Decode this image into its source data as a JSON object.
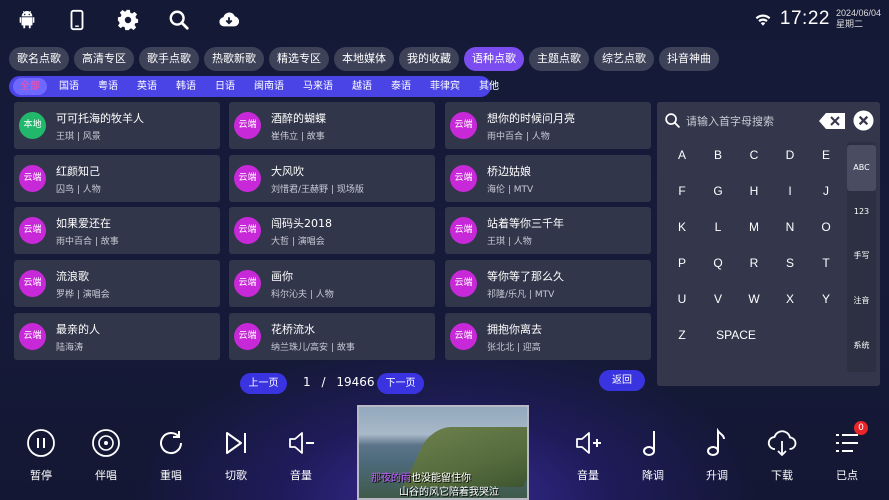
{
  "top_icons": [
    "android-icon",
    "phone-icon",
    "gear-icon",
    "search-icon",
    "cloud-download-icon"
  ],
  "status": {
    "time": "17:22",
    "date": "2024/06/04",
    "weekday": "星期二"
  },
  "tabs": [
    "歌名点歌",
    "高清专区",
    "歌手点歌",
    "热歌新歌",
    "精选专区",
    "本地媒体",
    "我的收藏",
    "语种点歌",
    "主题点歌",
    "综艺点歌",
    "抖音神曲"
  ],
  "active_tab": "语种点歌",
  "languages": [
    "全部",
    "国语",
    "粤语",
    "英语",
    "韩语",
    "日语",
    "闽南语",
    "马来语",
    "越语",
    "泰语",
    "菲律宾",
    "其他"
  ],
  "active_language": "全部",
  "songs": [
    {
      "badge": "本地",
      "title": "可可托海的牧羊人",
      "singer": "王琪",
      "tag": "风景"
    },
    {
      "badge": "云端",
      "title": "酒醉的蝴蝶",
      "singer": "崔伟立",
      "tag": "故事"
    },
    {
      "badge": "云端",
      "title": "想你的时候问月亮",
      "singer": "雨中百合",
      "tag": "人物"
    },
    {
      "badge": "云端",
      "title": "红颜知己",
      "singer": "囚鸟",
      "tag": "人物"
    },
    {
      "badge": "云端",
      "title": "大风吹",
      "singer": "刘惜君/王赫野",
      "tag": "现场版"
    },
    {
      "badge": "云端",
      "title": "桥边姑娘",
      "singer": "海伦",
      "tag": "MTV"
    },
    {
      "badge": "云端",
      "title": "如果爱还在",
      "singer": "雨中百合",
      "tag": "故事"
    },
    {
      "badge": "云端",
      "title": "闯码头2018",
      "singer": "大哲",
      "tag": "演唱会"
    },
    {
      "badge": "云端",
      "title": "站着等你三千年",
      "singer": "王琪",
      "tag": "人物"
    },
    {
      "badge": "云端",
      "title": "流浪歌",
      "singer": "罗桦",
      "tag": "演唱会"
    },
    {
      "badge": "云端",
      "title": "画你",
      "singer": "科尔沁夫",
      "tag": "人物"
    },
    {
      "badge": "云端",
      "title": "等你等了那么久",
      "singer": "祁隆/乐凡",
      "tag": "MTV"
    },
    {
      "badge": "云端",
      "title": "最亲的人",
      "singer": "陆海涛",
      "tag": ""
    },
    {
      "badge": "云端",
      "title": "花桥流水",
      "singer": "纳兰珠儿/高安",
      "tag": "故事"
    },
    {
      "badge": "云端",
      "title": "拥抱你离去",
      "singer": "张北北",
      "tag": "迎高"
    }
  ],
  "pager": {
    "prev": "上一页",
    "current": "1",
    "separator": "/",
    "total": "19466",
    "next": "下一页",
    "back": "返回"
  },
  "keyboard": {
    "placeholder": "请输入首字母搜索",
    "keys": [
      "A",
      "B",
      "C",
      "D",
      "E",
      "F",
      "G",
      "H",
      "I",
      "J",
      "K",
      "L",
      "M",
      "N",
      "O",
      "P",
      "Q",
      "R",
      "S",
      "T",
      "U",
      "V",
      "W",
      "X",
      "Y",
      "Z",
      "SPACE"
    ],
    "modes": [
      "ABC",
      "123",
      "手写",
      "注音",
      "系统"
    ],
    "active_mode": "ABC"
  },
  "left_controls": [
    {
      "icon": "pause-icon",
      "label": "暂停"
    },
    {
      "icon": "disc-icon",
      "label": "伴唱"
    },
    {
      "icon": "replay-icon",
      "label": "重唱"
    },
    {
      "icon": "skip-next-icon",
      "label": "切歌"
    },
    {
      "icon": "volume-down-icon",
      "label": "音量"
    }
  ],
  "right_controls": [
    {
      "icon": "volume-up-icon",
      "label": "音量"
    },
    {
      "icon": "music-note-down-icon",
      "label": "降调"
    },
    {
      "icon": "music-note-up-icon",
      "label": "升调"
    },
    {
      "icon": "cloud-download-icon",
      "label": "下载"
    },
    {
      "icon": "playlist-icon",
      "label": "已点"
    }
  ],
  "queue_badge": "0",
  "video": {
    "lyric_sung": "那夜的雨",
    "lyric_rest": "也没能留住你",
    "lyric_line2": "山谷的风它陪着我哭泣"
  },
  "colors": {
    "accent": "#7b4df0",
    "lang_bar": "#4a43e6",
    "cloud_badge": "#c728d8",
    "local_badge": "#22b86c",
    "card": "#32364a"
  }
}
